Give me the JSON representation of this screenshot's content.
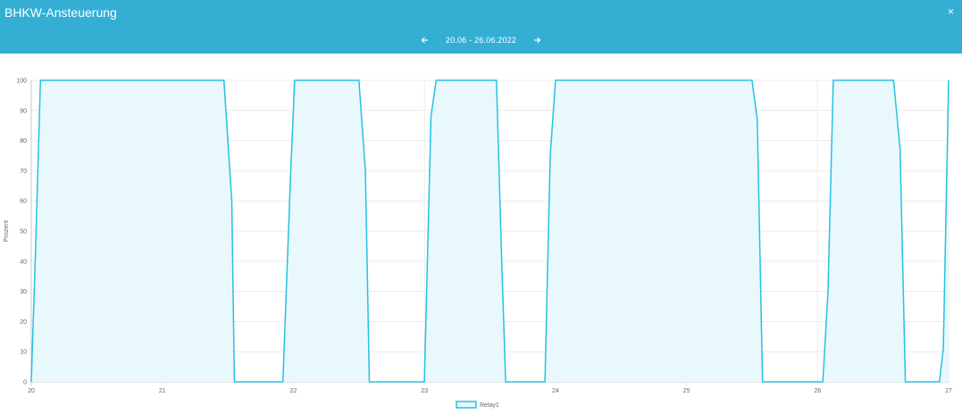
{
  "header": {
    "title": "BHKW-Ansteuerung",
    "close_label": "×",
    "date_range": "20.06 - 26.06.2022"
  },
  "colors": {
    "header_bg": "#35aed4",
    "line": "#26c1e2",
    "fill": "#e9f8fc"
  },
  "chart_data": {
    "type": "area",
    "title": "",
    "xlabel": "",
    "ylabel": "Prozent",
    "xlim": [
      20,
      27
    ],
    "ylim": [
      0,
      100
    ],
    "x_ticks": [
      "20",
      "21",
      "22",
      "23",
      "24",
      "25",
      "26",
      "27"
    ],
    "y_ticks": [
      "0",
      "10",
      "20",
      "30",
      "40",
      "50",
      "60",
      "70",
      "80",
      "90",
      "100"
    ],
    "grid": true,
    "legend_position": "bottom-center",
    "series": [
      {
        "name": "Relay1",
        "points": [
          [
            20.0,
            0
          ],
          [
            20.03,
            40
          ],
          [
            20.07,
            100
          ],
          [
            21.47,
            100
          ],
          [
            21.53,
            60
          ],
          [
            21.55,
            0
          ],
          [
            21.92,
            0
          ],
          [
            21.98,
            70
          ],
          [
            22.01,
            100
          ],
          [
            22.5,
            100
          ],
          [
            22.55,
            70
          ],
          [
            22.58,
            0
          ],
          [
            23.0,
            0
          ],
          [
            23.05,
            88
          ],
          [
            23.09,
            100
          ],
          [
            23.55,
            100
          ],
          [
            23.59,
            40
          ],
          [
            23.62,
            0
          ],
          [
            23.92,
            0
          ],
          [
            23.96,
            75
          ],
          [
            24.0,
            100
          ],
          [
            25.5,
            100
          ],
          [
            25.54,
            87
          ],
          [
            25.58,
            0
          ],
          [
            26.04,
            0
          ],
          [
            26.08,
            30
          ],
          [
            26.12,
            100
          ],
          [
            26.58,
            100
          ],
          [
            26.63,
            77
          ],
          [
            26.67,
            0
          ],
          [
            26.93,
            0
          ],
          [
            26.96,
            11
          ],
          [
            27.0,
            100
          ]
        ]
      }
    ]
  }
}
